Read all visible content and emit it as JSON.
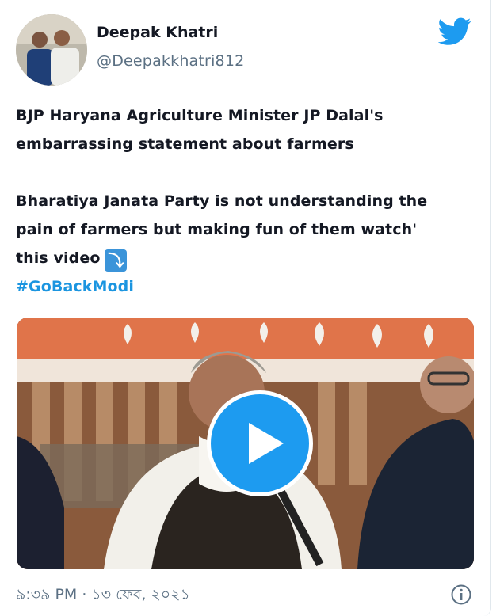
{
  "author": {
    "name": "Deepak Khatri",
    "handle": "@Deepakkhatri812"
  },
  "tweet": {
    "lines": [
      "BJP Haryana Agriculture Minister JP Dalal's",
      "embarrassing statement about farmers",
      "",
      "Bharatiya Janata Party is not understanding the",
      "pain of farmers but making fun of them watch'",
      "this video"
    ],
    "arrow_emoji": "⤵",
    "hashtag": "#GoBackModi"
  },
  "timestamp": "৯:৩৯ PM · ১৩ ফেব, ২০২১",
  "icons": {
    "brand": "twitter-bird-icon",
    "play": "play-icon",
    "info": "info-icon"
  },
  "colors": {
    "brand": "#1d9bf0",
    "hashtag": "#1b95e0",
    "muted": "#5b7083"
  }
}
